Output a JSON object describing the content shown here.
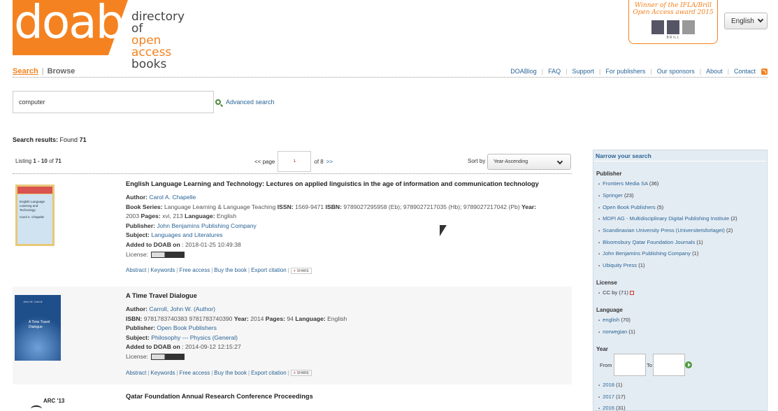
{
  "header": {
    "logo_text": "doab",
    "tagline": [
      "directory of",
      "open access",
      "books"
    ],
    "award": [
      "Winner of the IFLA/Brill",
      "Open Access award 2015"
    ],
    "award_brill": "BRILL",
    "language": "English"
  },
  "nav": {
    "search": "Search",
    "browse": "Browse",
    "links": [
      "DOABlog",
      "FAQ",
      "Support",
      "For publishers",
      "Our sponsors",
      "About",
      "Contact"
    ]
  },
  "search": {
    "value": "computer",
    "advanced": "Advanced search"
  },
  "results": {
    "label": "Search results:",
    "found_label": "Found",
    "count": "71",
    "listing_prefix": "Listing",
    "range": "1 - 10",
    "of": "of",
    "total": "71",
    "page_prefix": "<< page",
    "page_value": "1",
    "page_of": "of 8",
    "page_next": ">>",
    "sort_label": "Sort by",
    "sort_value": "Year-Ascending"
  },
  "records": [
    {
      "title": "English Language Learning and Technology: Lectures on applied linguistics in the age of information and communication technology",
      "author_label": "Author:",
      "author": "Carol A. Chapelle",
      "series_label": "Book Series:",
      "series": "Language Learning & Language Teaching",
      "issn_label": "ISSN:",
      "issn": "1569-9471",
      "isbn_label": "ISBN:",
      "isbn": "9789027295958 (Eb); 9789027217035 (Hb); 9789027217042 (Pb)",
      "year_label": "Year:",
      "year": "2003",
      "pages_label": "Pages:",
      "pages": "xvi, 213",
      "language_label": "Language:",
      "language": "English",
      "publisher_label": "Publisher:",
      "publisher": "John Benjamins Publishing Company",
      "subject_label": "Subject:",
      "subject": "Languages and Literatures",
      "added_label": "Added to DOAB on",
      "added": ": 2018-01-25 10:49:38",
      "license_label": "License:",
      "cover_title": "English Language Learning and Technology",
      "cover_author": "Carol A. Chapelle"
    },
    {
      "title": "A Time Travel Dialogue",
      "author_label": "Author:",
      "author": "Carroll, John W. (Author)",
      "isbn_label": "ISBN:",
      "isbn": "9781783740383 9781783740390",
      "year_label": "Year:",
      "year": "2014",
      "pages_label": "Pages:",
      "pages": "94",
      "language_label": "Language:",
      "language": "English",
      "publisher_label": "Publisher:",
      "publisher": "Open Book Publishers",
      "subject_label": "Subject:",
      "subject": "Philosophy --- Physics (General)",
      "added_label": "Added to DOAB on",
      "added": ": 2014-09-12 12:15:27",
      "license_label": "License:",
      "cover_title": "A Time Travel Dialogue",
      "cover_author": "John W. Carroll"
    },
    {
      "title": "Qatar Foundation Annual Research Conference Proceedings",
      "cover_title": "ARC '13"
    }
  ],
  "actions": [
    "Abstract",
    "Keywords",
    "Free access",
    "Buy the book",
    "Export citation"
  ],
  "share": "SHARE",
  "sidebar": {
    "title": "Narrow your search",
    "publisher_heading": "Publisher",
    "publishers": [
      {
        "name": "Frontiers Media SA",
        "count": "(36)"
      },
      {
        "name": "Springer",
        "count": "(23)"
      },
      {
        "name": "Open Book Publishers",
        "count": "(5)"
      },
      {
        "name": "MDPI AG - Multidisciplinary Digital Publishing Institute",
        "count": "(2)"
      },
      {
        "name": "Scandinavian University Press (Universitetsforlaget)",
        "count": "(2)"
      },
      {
        "name": "Bloomsbury Qatar Foundation Journals",
        "count": "(1)"
      },
      {
        "name": "John Benjamins Publishing Company",
        "count": "(1)"
      },
      {
        "name": "Ubiquity Press",
        "count": "(1)"
      }
    ],
    "license_heading": "License",
    "licenses": [
      {
        "name": "CC by",
        "count": "(71)"
      }
    ],
    "language_heading": "Language",
    "languages": [
      {
        "name": "english",
        "count": "(70)"
      },
      {
        "name": "norwegian",
        "count": "(1)"
      }
    ],
    "year_heading": "Year",
    "from_label": "From",
    "to_label": "To",
    "years": [
      {
        "name": "2018",
        "count": "(1)"
      },
      {
        "name": "2017",
        "count": "(17)"
      },
      {
        "name": "2016",
        "count": "(31)"
      }
    ]
  },
  "colors": {
    "brand_orange": "#f58220",
    "link_blue": "#2a6496",
    "sidebar_bg": "#e4ecf3"
  }
}
